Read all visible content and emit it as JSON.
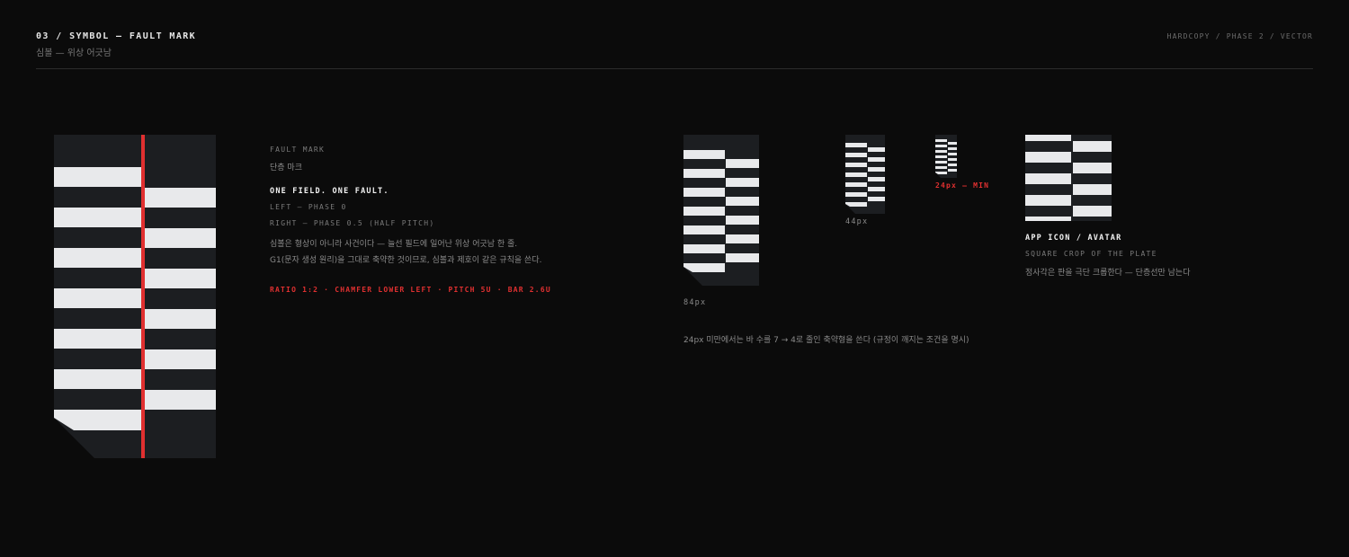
{
  "header": {
    "title": "03 / SYMBOL — FAULT MARK",
    "subtitle": "심볼 — 위상 어긋남",
    "meta": "HARDCOPY / PHASE 2 / VECTOR"
  },
  "colors": {
    "background": "#0b0b0b",
    "plate": "#1c1e21",
    "bar": "#e8e9eb",
    "fault": "#e03030"
  },
  "main_mark": {
    "label": "FAULT MARK",
    "label_kr": "단층 마크",
    "headline": "ONE FIELD. ONE FAULT.",
    "left_spec": "LEFT — PHASE 0",
    "right_spec": "RIGHT — PHASE 0.5 (HALF PITCH)",
    "desc_1": "심볼은 형상이 아니라 사건이다 — 늘선 필드에 일어난 위상 어긋남 한 줄.",
    "desc_2": "G1(문자 생성 원리)을 그대로 축약한 것이므로, 심볼과 제호이 같은 규칙을 쓴다.",
    "spec_line": "RATIO 1:2 · CHAMFER LOWER LEFT · PITCH 5U · BAR 2.6U"
  },
  "sizes": {
    "s84": "84px",
    "s44": "44px",
    "s24": "24px — MIN",
    "note": "24px 미만에서는 바 수를 7 → 4로 줄인 축약형을 쓴다 (규정이 깨지는 조건을 명시)"
  },
  "app_icon": {
    "title": "APP ICON / AVATAR",
    "subtitle": "SQUARE CROP OF THE PLATE",
    "desc": "정사각은 판을 극단 크롭한다 — 단층선만 남는다"
  }
}
